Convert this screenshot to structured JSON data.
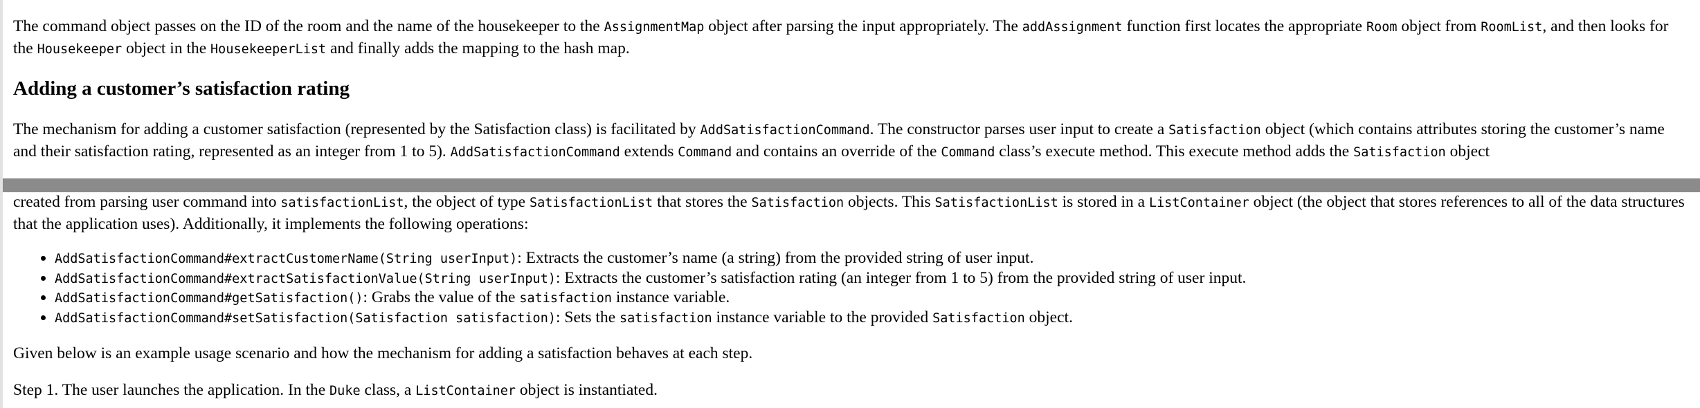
{
  "section_intro": {
    "t1": "The command object passes on the ID of the room and the name of the housekeeper to the ",
    "c1": "AssignmentMap",
    "t2": " object after parsing the input appropriately. The ",
    "c2": "addAssignment",
    "t3": " function first locates the appropriate ",
    "c3": "Room",
    "t4": " object from ",
    "c4": "RoomList",
    "t5": ", and then looks for the ",
    "c5": "Housekeeper",
    "t6": " object in the ",
    "c6": "HousekeeperList",
    "t7": " and finally adds the mapping to the hash map."
  },
  "heading": "Adding a customer’s satisfaction rating",
  "para2": {
    "t1": "The mechanism for adding a customer satisfaction (represented by the Satisfaction class) is facilitated by ",
    "c1": "AddSatisfactionCommand",
    "t2": ". The constructor parses user input to create a ",
    "c2": "Satisfaction",
    "t3": " object (which contains attributes storing the customer’s name and their satisfaction rating, represented as an integer from 1 to 5). ",
    "c3": "AddSatisfactionCommand",
    "t4": " extends ",
    "c4": "Command",
    "t5": " and contains an override of the ",
    "c5": "Command",
    "t6": " class’s execute method. This execute method adds the ",
    "c6": "Satisfaction",
    "t7": " object"
  },
  "para3": {
    "t1": "created from parsing user command into ",
    "c1": "satisfactionList",
    "t2": ", the object of type ",
    "c2": "SatisfactionList",
    "t3": " that stores the ",
    "c3": "Satisfaction",
    "t4": " objects. This ",
    "c4": "SatisfactionList",
    "t5": " is stored in a ",
    "c5": "ListContainer",
    "t6": " object (the object that stores references to all of the data structures that the application uses). Additionally, it implements the following operations:"
  },
  "operations": [
    {
      "code": "AddSatisfactionCommand#extractCustomerName(String userInput)",
      "text": ": Extracts the customer’s name (a string) from the provided string of user input."
    },
    {
      "code": "AddSatisfactionCommand#extractSatisfactionValue(String userInput)",
      "text": ": Extracts the customer’s satisfaction rating (an integer from 1 to 5) from the provided string of user input."
    },
    {
      "code": "AddSatisfactionCommand#getSatisfaction()",
      "text": ": Grabs the value of the ",
      "code2": "satisfaction",
      "text2": " instance variable."
    },
    {
      "code": "AddSatisfactionCommand#setSatisfaction(Satisfaction satisfaction)",
      "text": ": Sets the ",
      "code2": "satisfaction",
      "text2": " instance variable to the provided ",
      "code3": "Satisfaction",
      "text3": " object."
    }
  ],
  "para4": "Given below is an example usage scenario and how the mechanism for adding a satisfaction behaves at each step.",
  "para5": {
    "t1": "Step 1. The user launches the application. In the ",
    "c1": "Duke",
    "t2": " class, a ",
    "c2": "ListContainer",
    "t3": " object is instantiated."
  }
}
